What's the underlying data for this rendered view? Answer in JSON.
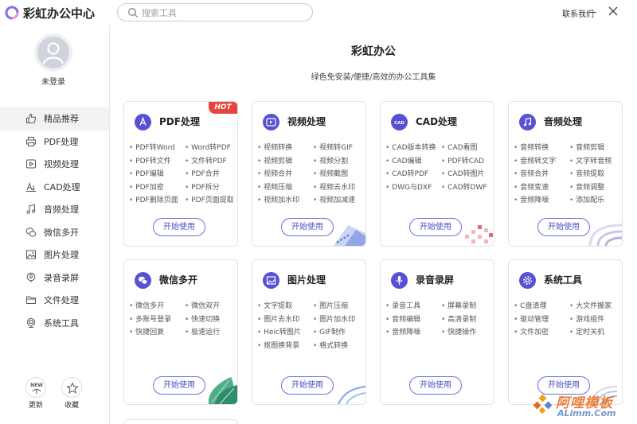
{
  "app": {
    "title": "彩虹办公中心"
  },
  "search": {
    "placeholder": "搜索工具"
  },
  "header": {
    "contact": "联系我们"
  },
  "user": {
    "status": "未登录"
  },
  "sidebar": {
    "items": [
      {
        "label": "精品推荐",
        "icon": "thumbs-up-icon",
        "active": true
      },
      {
        "label": "PDF处理",
        "icon": "printer-icon"
      },
      {
        "label": "视频处理",
        "icon": "play-icon"
      },
      {
        "label": "CAD处理",
        "icon": "cad-icon"
      },
      {
        "label": "音频处理",
        "icon": "music-icon"
      },
      {
        "label": "微信多开",
        "icon": "wechat-icon"
      },
      {
        "label": "图片处理",
        "icon": "image-icon"
      },
      {
        "label": "录音录屏",
        "icon": "mic-icon"
      },
      {
        "label": "文件处理",
        "icon": "folder-icon"
      },
      {
        "label": "系统工具",
        "icon": "monitor-icon"
      }
    ],
    "update_label": "更新",
    "favorite_label": "收藏",
    "new_badge": "NEW"
  },
  "main": {
    "headline": "彩虹办公",
    "subline": "绿色免安装/便捷/高效的办公工具集",
    "start_label": "开始使用",
    "hot_badge": "HOT",
    "cards": [
      {
        "title": "PDF处理",
        "icon": "pdf-icon",
        "color": "#5b4fd6",
        "features": [
          "PDF转Word",
          "Word转PDF",
          "PDF转文件",
          "文件转PDF",
          "PDF编辑",
          "PDF合并",
          "PDF加密",
          "PDF拆分",
          "PDF删除页面",
          "PDF页面提取"
        ]
      },
      {
        "title": "视频处理",
        "icon": "video-icon",
        "color": "#5b4fd6",
        "features": [
          "视频转换",
          "视频转GIF",
          "视频剪辑",
          "视频分割",
          "视频合并",
          "视频截图",
          "视频压缩",
          "视频去水印",
          "视频加水印",
          "视频加减速"
        ]
      },
      {
        "title": "CAD处理",
        "icon": "cad-icon",
        "color": "#5b4fd6",
        "features": [
          "CAD版本转换",
          "CAD看图",
          "CAD编辑",
          "PDF转CAD",
          "CAD转PDF",
          "CAD转图片",
          "DWG与DXF",
          "CAD转DWF"
        ]
      },
      {
        "title": "音频处理",
        "icon": "music-icon",
        "color": "#5b4fd6",
        "features": [
          "音频转换",
          "音频剪辑",
          "音频转文字",
          "文字转音频",
          "音频合并",
          "音频提取",
          "音频变速",
          "音频调整",
          "音频降噪",
          "添加配乐"
        ]
      },
      {
        "title": "微信多开",
        "icon": "wechat-icon",
        "color": "#5b4fd6",
        "features": [
          "微信多开",
          "微信双开",
          "多账号登录",
          "快速切换",
          "快捷回复",
          "极速运行"
        ]
      },
      {
        "title": "图片处理",
        "icon": "image-icon",
        "color": "#5b4fd6",
        "features": [
          "文字提取",
          "图片压缩",
          "图片去水印",
          "图片加水印",
          "Heic转图片",
          "GIF制作",
          "抠图换背景",
          "格式转换"
        ]
      },
      {
        "title": "录音录屏",
        "icon": "mic-icon",
        "color": "#5b4fd6",
        "features": [
          "录音工具",
          "屏幕录制",
          "音频编辑",
          "高清录制",
          "音频降噪",
          "快捷操作"
        ]
      },
      {
        "title": "系统工具",
        "icon": "gear-icon",
        "color": "#5b4fd6",
        "features": [
          "C盘清理",
          "大文件搬家",
          "驱动管理",
          "游戏组件",
          "文件加密",
          "定时关机"
        ]
      }
    ]
  },
  "watermark": {
    "line1": "阿哩模板",
    "line2": "ALimm.Com"
  }
}
